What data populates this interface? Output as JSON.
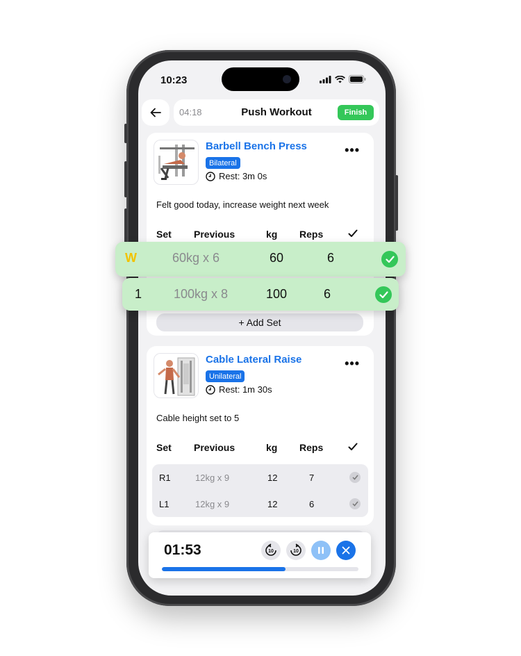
{
  "status": {
    "time": "10:23"
  },
  "nav": {
    "timer": "04:18",
    "title": "Push Workout",
    "finish_label": "Finish"
  },
  "table_headers": {
    "set": "Set",
    "previous": "Previous",
    "kg": "kg",
    "reps": "Reps"
  },
  "exercises": [
    {
      "title": "Barbell Bench Press",
      "badge": "Bilateral",
      "rest": "Rest: 3m 0s",
      "notes": "Felt good today, increase weight next week",
      "add_set_label": "+ Add Set",
      "sets": [
        {
          "set": "W",
          "previous": "60kg x 6",
          "kg": "60",
          "reps": "6",
          "done": true
        },
        {
          "set": "1",
          "previous": "100kg x 8",
          "kg": "100",
          "reps": "6",
          "done": true
        }
      ]
    },
    {
      "title": "Cable Lateral Raise",
      "badge": "Unilateral",
      "rest": "Rest: 1m 30s",
      "notes": "Cable height set to 5",
      "sets": [
        {
          "set": "R1",
          "previous": "12kg x 9",
          "kg": "12",
          "reps": "7",
          "done": false
        },
        {
          "set": "L1",
          "previous": "12kg x 9",
          "kg": "12",
          "reps": "6",
          "done": false
        }
      ]
    }
  ],
  "rest_timer": {
    "time": "01:53",
    "progress": 0.63,
    "skip_label": "10"
  },
  "colors": {
    "accent": "#1a73e8",
    "success": "#34c759",
    "warmup": "#f2c200"
  }
}
